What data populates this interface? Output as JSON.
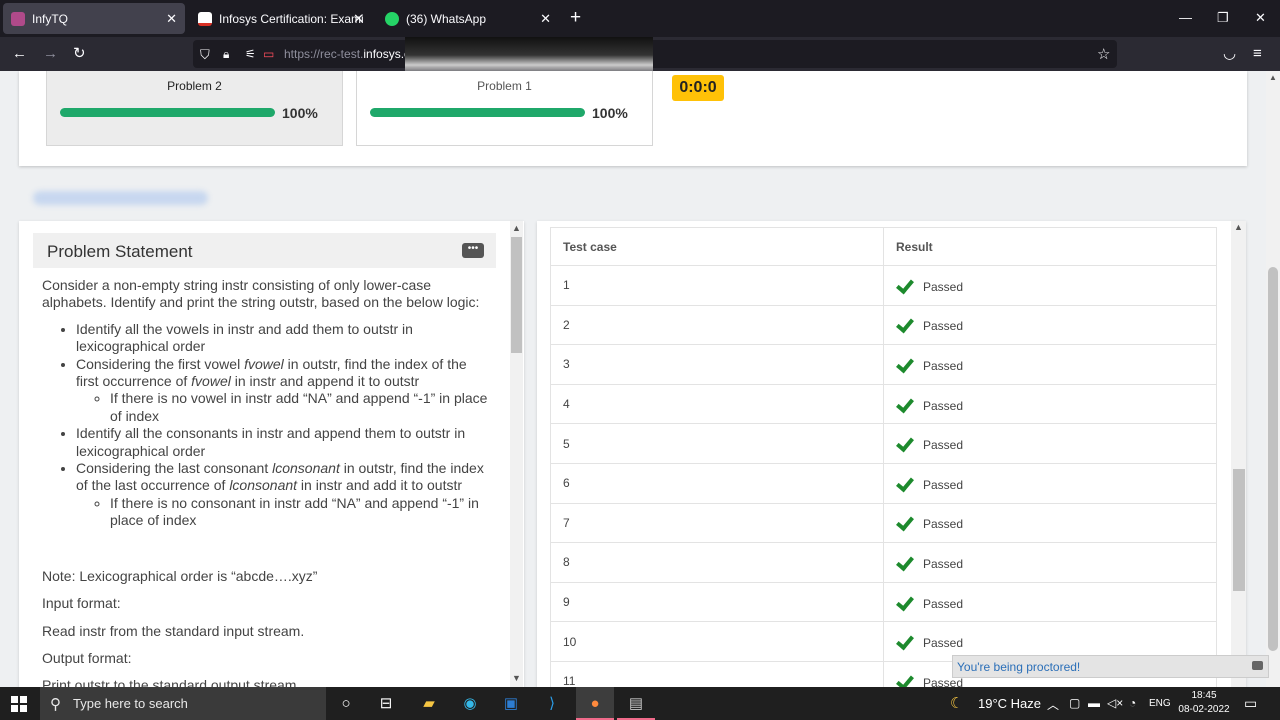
{
  "browser": {
    "tabs": [
      {
        "title": "InfyTQ",
        "active": true,
        "favicon": "infytq-icon"
      },
      {
        "title": "Infosys Certification: Examinatic",
        "active": false,
        "favicon": "gmail-icon"
      },
      {
        "title": "(36) WhatsApp",
        "active": false,
        "favicon": "whatsapp-icon"
      }
    ],
    "url_dim": "https://rec-test.",
    "url_host": "infosys.c"
  },
  "problems": [
    {
      "name": "Problem 2",
      "progress_label": "100%",
      "progress": 1.0,
      "selected": true
    },
    {
      "name": "Problem 1",
      "progress_label": "100%",
      "progress": 1.0,
      "selected": false
    }
  ],
  "timer": "0:0:0",
  "statement": {
    "title": "Problem Statement",
    "intro": "Consider a non-empty string instr consisting of only lower-case alphabets. Identify and print the string outstr, based on the below logic:",
    "b1": "Identify all the vowels in instr and add them to outstr in lexicographical order",
    "b2_pre": "Considering the first vowel ",
    "b2_em1": "fvowel",
    "b2_mid": " in outstr, find the index of the first occurrence of ",
    "b2_em2": "fvowel",
    "b2_post": " in instr and append it to outstr",
    "b2_sub": "If there is no vowel in instr add “NA” and append “-1” in place of index",
    "b3": "Identify all the consonants in instr and append them to outstr in lexicographical order",
    "b4_pre": "Considering the last consonant ",
    "b4_em1": "lconsonant",
    "b4_mid": " in outstr, find the index of the last occurrence of ",
    "b4_em2": "lconsonant",
    "b4_post": " in instr and add it to outstr",
    "b4_sub": "If there is no consonant in instr add “NA” and append “-1” in place of index",
    "note": "Note: Lexicographical order  is “abcde….xyz”",
    "input_label": "Input format:",
    "input_text": "Read instr from the standard input stream.",
    "output_label": "Output format:",
    "output_text": "Print outstr to the standard output stream."
  },
  "results": {
    "headers": [
      "Test case",
      "Result"
    ],
    "rows": [
      {
        "case": "1",
        "result": "Passed"
      },
      {
        "case": "2",
        "result": "Passed"
      },
      {
        "case": "3",
        "result": "Passed"
      },
      {
        "case": "4",
        "result": "Passed"
      },
      {
        "case": "5",
        "result": "Passed"
      },
      {
        "case": "6",
        "result": "Passed"
      },
      {
        "case": "7",
        "result": "Passed"
      },
      {
        "case": "8",
        "result": "Passed"
      },
      {
        "case": "9",
        "result": "Passed"
      },
      {
        "case": "10",
        "result": "Passed"
      },
      {
        "case": "11",
        "result": "Passed"
      }
    ]
  },
  "proctor_text": "You're being proctored!",
  "taskbar": {
    "search_placeholder": "Type here to search",
    "weather": "19°C  Haze",
    "lang": "ENG",
    "time": "18:45",
    "date": "08-02-2022"
  },
  "colors": {
    "progress": "#1fa86a",
    "timer_bg": "#ffc107",
    "check": "#1d8a2d",
    "proctor_text": "#2b6fb8"
  }
}
